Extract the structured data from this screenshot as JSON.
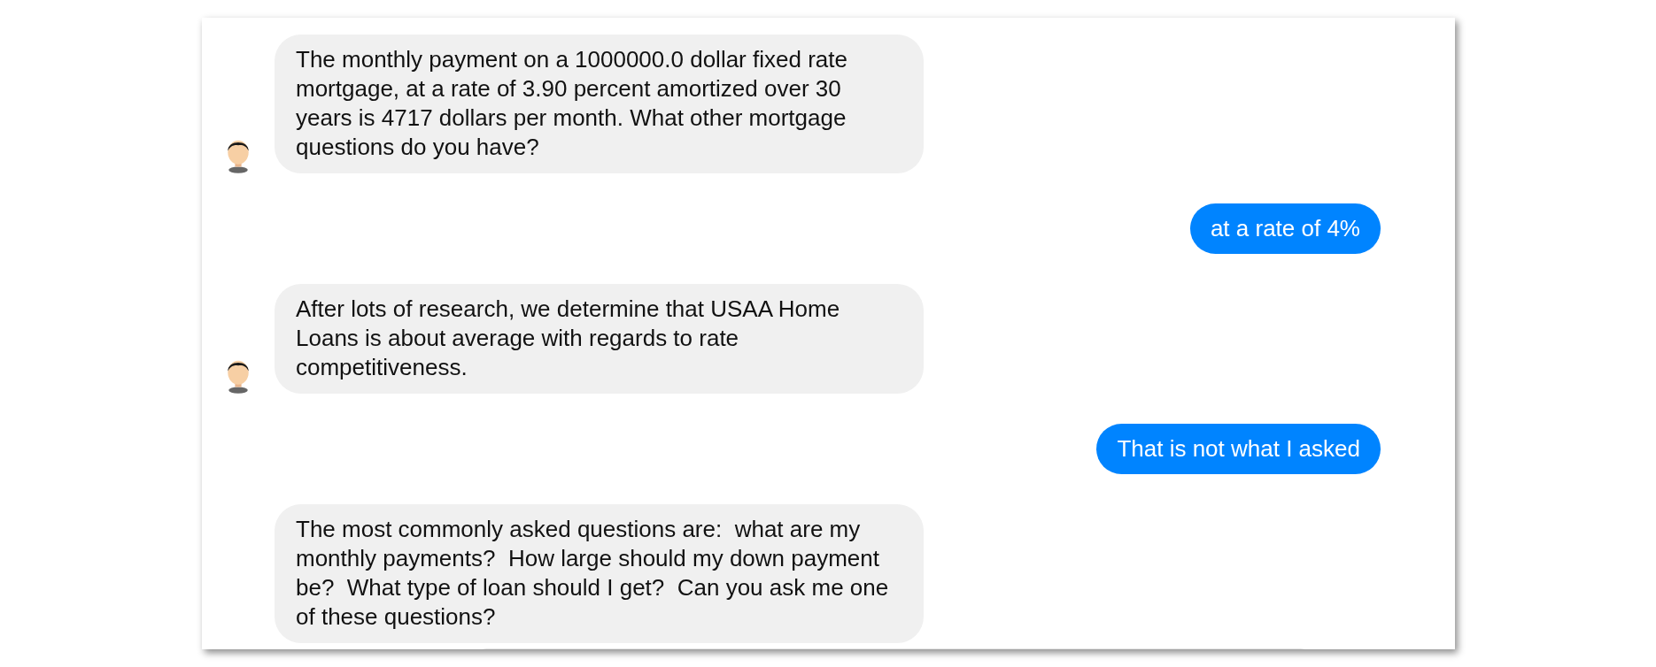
{
  "messages": [
    {
      "kind": "bot",
      "avatar": true,
      "text": "The monthly payment on a 1000000.0 dollar fixed rate mortgage, at a rate of 3.90 percent amortized over 30 years is 4717 dollars per month. What other mortgage questions do you have?"
    },
    {
      "kind": "user",
      "text": "at a rate of 4%"
    },
    {
      "kind": "bot",
      "avatar": true,
      "text": "After lots of research, we determine that USAA Home Loans is about average with regards to rate competitiveness."
    },
    {
      "kind": "user",
      "text": "That is not what I asked"
    },
    {
      "kind": "bot",
      "avatar": false,
      "text": "The most commonly asked questions are:  what are my monthly payments?  How large should my down payment be?  What type of loan should I get?  Can you ask me one of these questions?"
    }
  ]
}
